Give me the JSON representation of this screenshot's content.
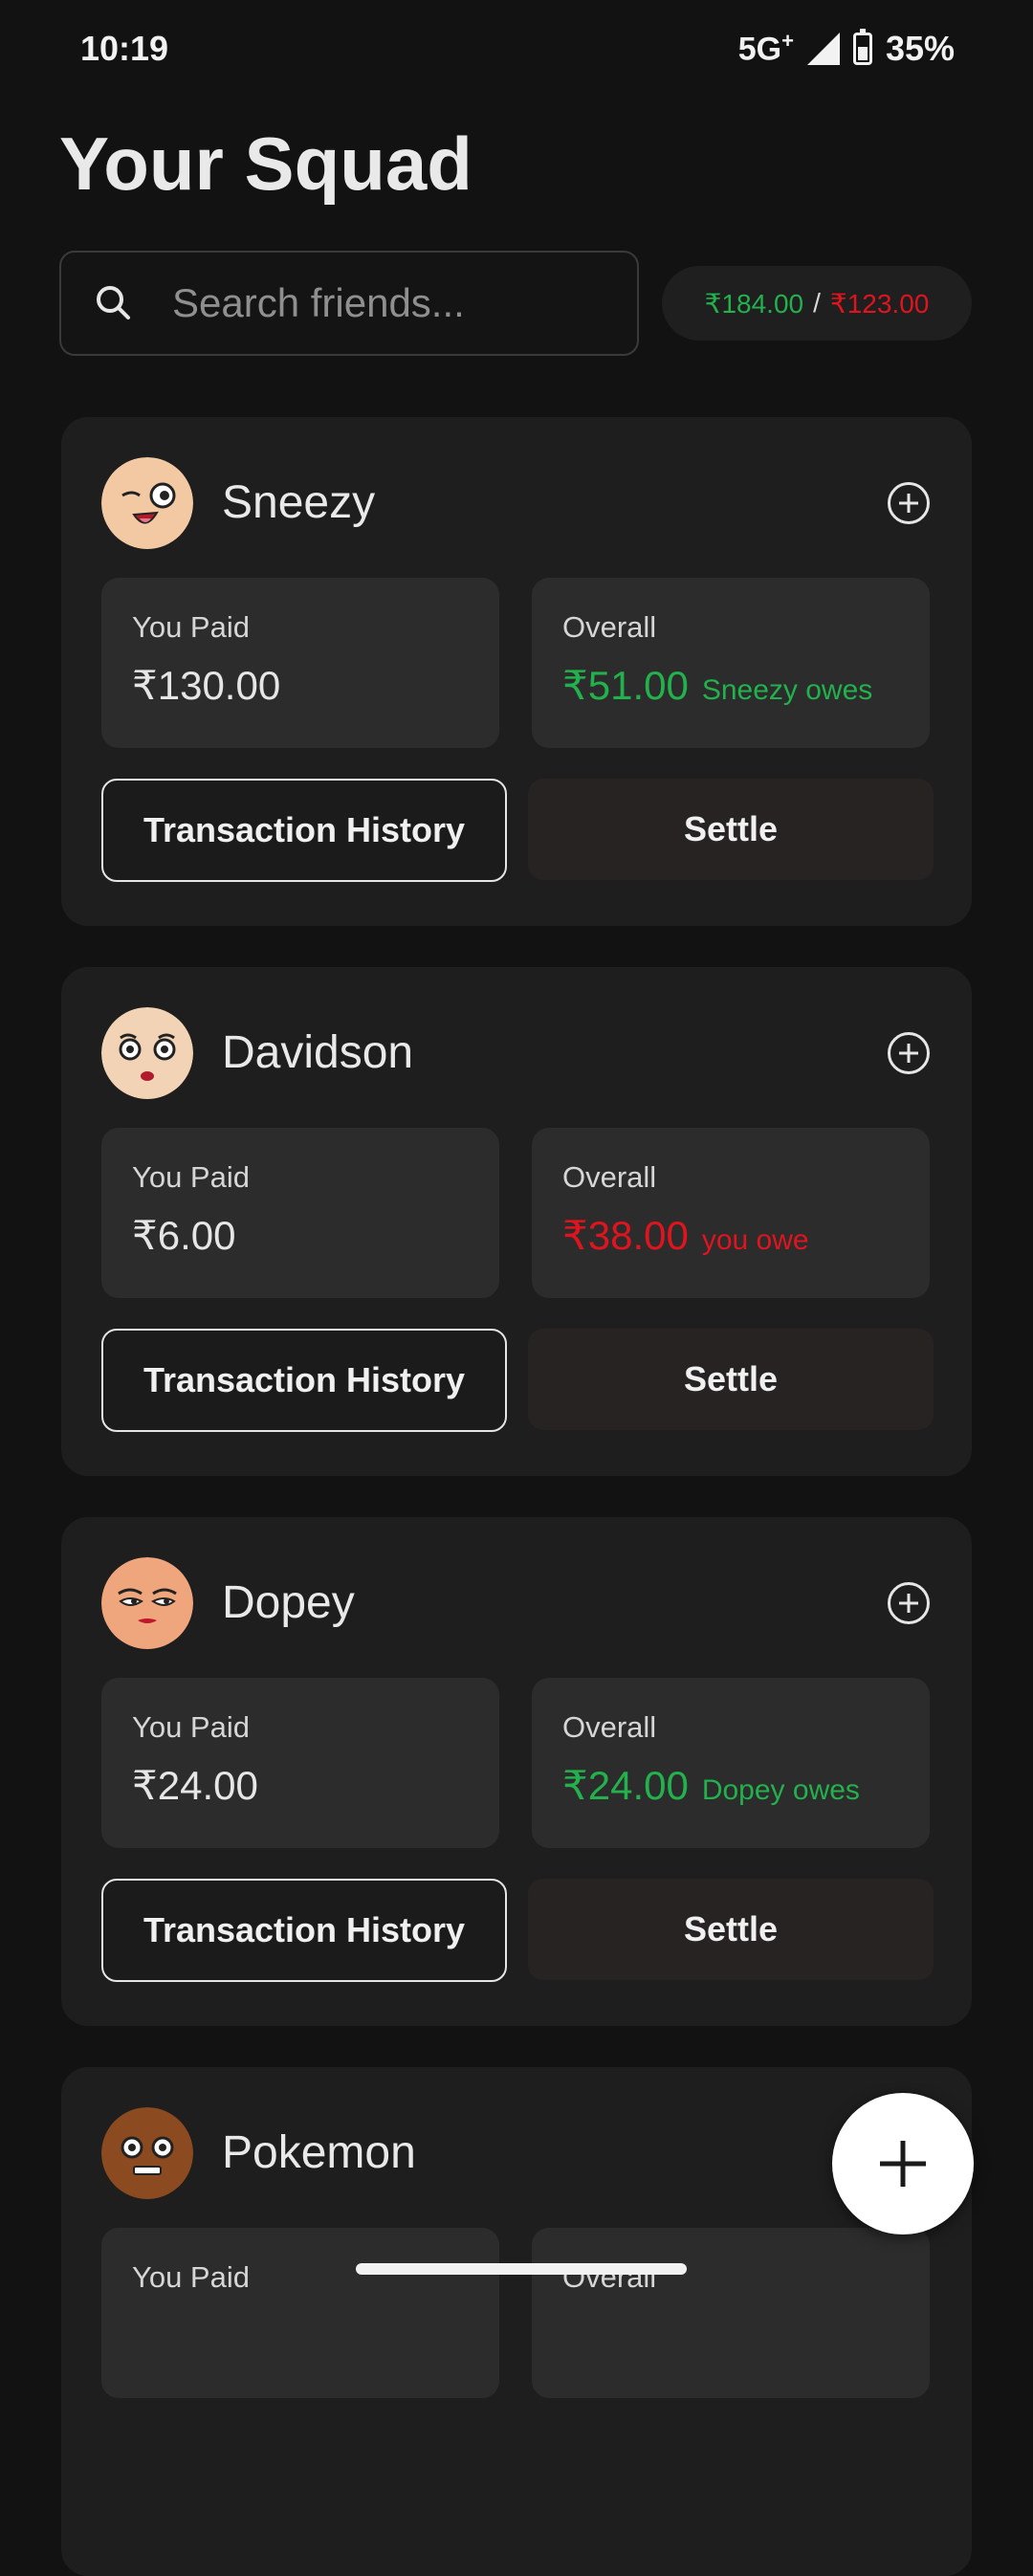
{
  "status_bar": {
    "time": "10:19",
    "network": "5G",
    "network_sup": "+",
    "battery": "35%"
  },
  "page_title": "Your Squad",
  "search": {
    "placeholder": "Search friends..."
  },
  "totals": {
    "owed_to_you": "₹184.00",
    "separator": "/",
    "you_owe": "₹123.00"
  },
  "labels": {
    "you_paid": "You Paid",
    "overall": "Overall",
    "transaction_history": "Transaction History",
    "settle": "Settle"
  },
  "friends": [
    {
      "name": "Sneezy",
      "you_paid": "₹130.00",
      "overall_amount": "₹51.00",
      "overall_note": "Sneezy owes",
      "status": "owed"
    },
    {
      "name": "Davidson",
      "you_paid": "₹6.00",
      "overall_amount": "₹38.00",
      "overall_note": "you owe",
      "status": "owe"
    },
    {
      "name": "Dopey",
      "you_paid": "₹24.00",
      "overall_amount": "₹24.00",
      "overall_note": "Dopey owes",
      "status": "owed"
    },
    {
      "name": "Pokemon"
    }
  ],
  "colors": {
    "positive": "#22b14c",
    "negative": "#e0141e",
    "background": "#121212",
    "card": "#1e1e1e"
  }
}
